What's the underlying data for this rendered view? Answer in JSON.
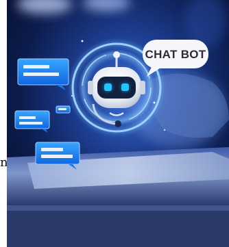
{
  "image": {
    "bubble_label": "CHAT BOT",
    "stray_text": "n",
    "icons": [
      "robot-icon",
      "chat-bubble-icon"
    ],
    "colors": {
      "background_dark": "#0b1a44",
      "glow_blue": "#2f7bff",
      "bubble_blue": "#1e88ff",
      "robot_white": "#f2f4f8",
      "robot_eye": "#22c4ff"
    }
  }
}
